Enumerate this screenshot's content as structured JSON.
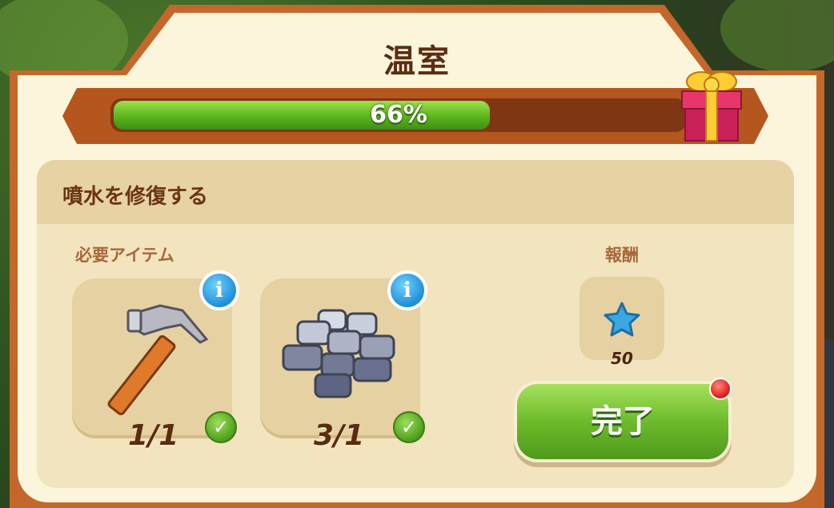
{
  "window": {
    "title": "温室"
  },
  "progress": {
    "value": 0.66,
    "label": "66%"
  },
  "task": {
    "title": "噴水を修復する",
    "required_label": "必要アイテム",
    "reward_label": "報酬",
    "items": [
      {
        "icon": "hammer-icon",
        "count": "1/1",
        "complete": true
      },
      {
        "icon": "stone-tiles-icon",
        "count": "3/1",
        "complete": true
      }
    ],
    "reward": {
      "icon": "blue-star-icon",
      "value": "50"
    },
    "complete_button": "完了"
  },
  "colors": {
    "frame": "#c4672a",
    "panel": "#fbf5dc",
    "progress_fill": "#5bb51c",
    "button": "#6dbb2c",
    "title_text": "#5b2d12"
  }
}
